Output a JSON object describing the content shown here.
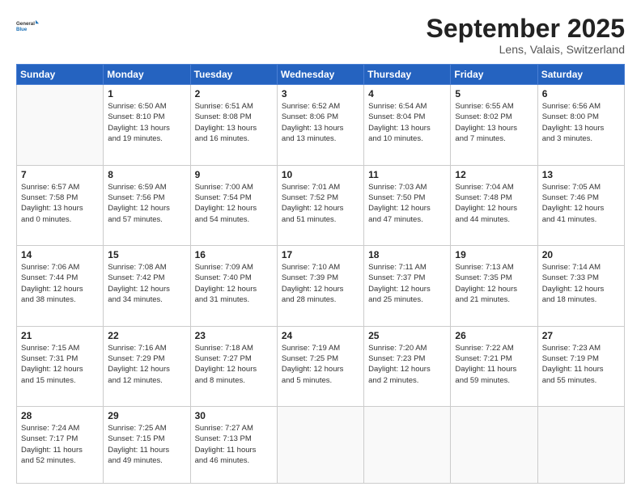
{
  "logo": {
    "general": "General",
    "blue": "Blue"
  },
  "header": {
    "month": "September 2025",
    "location": "Lens, Valais, Switzerland"
  },
  "days": [
    "Sunday",
    "Monday",
    "Tuesday",
    "Wednesday",
    "Thursday",
    "Friday",
    "Saturday"
  ],
  "weeks": [
    [
      {
        "day": "",
        "content": ""
      },
      {
        "day": "1",
        "content": "Sunrise: 6:50 AM\nSunset: 8:10 PM\nDaylight: 13 hours\nand 19 minutes."
      },
      {
        "day": "2",
        "content": "Sunrise: 6:51 AM\nSunset: 8:08 PM\nDaylight: 13 hours\nand 16 minutes."
      },
      {
        "day": "3",
        "content": "Sunrise: 6:52 AM\nSunset: 8:06 PM\nDaylight: 13 hours\nand 13 minutes."
      },
      {
        "day": "4",
        "content": "Sunrise: 6:54 AM\nSunset: 8:04 PM\nDaylight: 13 hours\nand 10 minutes."
      },
      {
        "day": "5",
        "content": "Sunrise: 6:55 AM\nSunset: 8:02 PM\nDaylight: 13 hours\nand 7 minutes."
      },
      {
        "day": "6",
        "content": "Sunrise: 6:56 AM\nSunset: 8:00 PM\nDaylight: 13 hours\nand 3 minutes."
      }
    ],
    [
      {
        "day": "7",
        "content": "Sunrise: 6:57 AM\nSunset: 7:58 PM\nDaylight: 13 hours\nand 0 minutes."
      },
      {
        "day": "8",
        "content": "Sunrise: 6:59 AM\nSunset: 7:56 PM\nDaylight: 12 hours\nand 57 minutes."
      },
      {
        "day": "9",
        "content": "Sunrise: 7:00 AM\nSunset: 7:54 PM\nDaylight: 12 hours\nand 54 minutes."
      },
      {
        "day": "10",
        "content": "Sunrise: 7:01 AM\nSunset: 7:52 PM\nDaylight: 12 hours\nand 51 minutes."
      },
      {
        "day": "11",
        "content": "Sunrise: 7:03 AM\nSunset: 7:50 PM\nDaylight: 12 hours\nand 47 minutes."
      },
      {
        "day": "12",
        "content": "Sunrise: 7:04 AM\nSunset: 7:48 PM\nDaylight: 12 hours\nand 44 minutes."
      },
      {
        "day": "13",
        "content": "Sunrise: 7:05 AM\nSunset: 7:46 PM\nDaylight: 12 hours\nand 41 minutes."
      }
    ],
    [
      {
        "day": "14",
        "content": "Sunrise: 7:06 AM\nSunset: 7:44 PM\nDaylight: 12 hours\nand 38 minutes."
      },
      {
        "day": "15",
        "content": "Sunrise: 7:08 AM\nSunset: 7:42 PM\nDaylight: 12 hours\nand 34 minutes."
      },
      {
        "day": "16",
        "content": "Sunrise: 7:09 AM\nSunset: 7:40 PM\nDaylight: 12 hours\nand 31 minutes."
      },
      {
        "day": "17",
        "content": "Sunrise: 7:10 AM\nSunset: 7:39 PM\nDaylight: 12 hours\nand 28 minutes."
      },
      {
        "day": "18",
        "content": "Sunrise: 7:11 AM\nSunset: 7:37 PM\nDaylight: 12 hours\nand 25 minutes."
      },
      {
        "day": "19",
        "content": "Sunrise: 7:13 AM\nSunset: 7:35 PM\nDaylight: 12 hours\nand 21 minutes."
      },
      {
        "day": "20",
        "content": "Sunrise: 7:14 AM\nSunset: 7:33 PM\nDaylight: 12 hours\nand 18 minutes."
      }
    ],
    [
      {
        "day": "21",
        "content": "Sunrise: 7:15 AM\nSunset: 7:31 PM\nDaylight: 12 hours\nand 15 minutes."
      },
      {
        "day": "22",
        "content": "Sunrise: 7:16 AM\nSunset: 7:29 PM\nDaylight: 12 hours\nand 12 minutes."
      },
      {
        "day": "23",
        "content": "Sunrise: 7:18 AM\nSunset: 7:27 PM\nDaylight: 12 hours\nand 8 minutes."
      },
      {
        "day": "24",
        "content": "Sunrise: 7:19 AM\nSunset: 7:25 PM\nDaylight: 12 hours\nand 5 minutes."
      },
      {
        "day": "25",
        "content": "Sunrise: 7:20 AM\nSunset: 7:23 PM\nDaylight: 12 hours\nand 2 minutes."
      },
      {
        "day": "26",
        "content": "Sunrise: 7:22 AM\nSunset: 7:21 PM\nDaylight: 11 hours\nand 59 minutes."
      },
      {
        "day": "27",
        "content": "Sunrise: 7:23 AM\nSunset: 7:19 PM\nDaylight: 11 hours\nand 55 minutes."
      }
    ],
    [
      {
        "day": "28",
        "content": "Sunrise: 7:24 AM\nSunset: 7:17 PM\nDaylight: 11 hours\nand 52 minutes."
      },
      {
        "day": "29",
        "content": "Sunrise: 7:25 AM\nSunset: 7:15 PM\nDaylight: 11 hours\nand 49 minutes."
      },
      {
        "day": "30",
        "content": "Sunrise: 7:27 AM\nSunset: 7:13 PM\nDaylight: 11 hours\nand 46 minutes."
      },
      {
        "day": "",
        "content": ""
      },
      {
        "day": "",
        "content": ""
      },
      {
        "day": "",
        "content": ""
      },
      {
        "day": "",
        "content": ""
      }
    ]
  ]
}
